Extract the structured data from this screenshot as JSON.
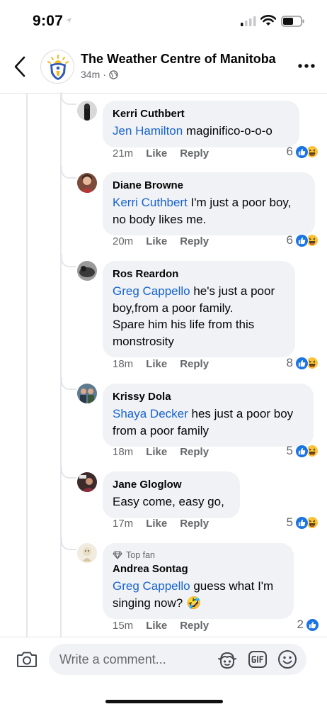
{
  "status_bar": {
    "time": "9:07"
  },
  "header": {
    "page_name": "The Weather Centre of Manitoba",
    "age": "34m",
    "separator": "·"
  },
  "comments": [
    {
      "author": "Kerri Cuthbert",
      "mention": "Jen Hamilton",
      "text": " maginifico-o-o-o",
      "time": "21m",
      "like": "Like",
      "reply": "Reply",
      "reaction_count": "6",
      "reactions": [
        "like-icon",
        "haha-icon"
      ]
    },
    {
      "author": "Diane Browne",
      "mention": "Kerri Cuthbert",
      "text": " I'm just a poor boy, no body likes me.",
      "time": "20m",
      "like": "Like",
      "reply": "Reply",
      "reaction_count": "6",
      "reactions": [
        "like-icon",
        "haha-icon"
      ]
    },
    {
      "author": "Ros Reardon",
      "mention": "Greg Cappello",
      "text": " he's just a poor boy,from a poor family.\nSpare him his life  from this monstrosity",
      "time": "18m",
      "like": "Like",
      "reply": "Reply",
      "reaction_count": "8",
      "reactions": [
        "like-icon",
        "haha-icon"
      ]
    },
    {
      "author": "Krissy Dola",
      "mention": "Shaya Decker",
      "text": " hes just a poor boy from a poor family",
      "time": "18m",
      "like": "Like",
      "reply": "Reply",
      "reaction_count": "5",
      "reactions": [
        "like-icon",
        "haha-icon"
      ]
    },
    {
      "author": "Jane Gloglow",
      "mention": "",
      "text": "Easy come, easy go,",
      "time": "17m",
      "like": "Like",
      "reply": "Reply",
      "reaction_count": "5",
      "reactions": [
        "like-icon",
        "haha-icon"
      ]
    },
    {
      "badge": "Top fan",
      "author": "Andrea Sontag",
      "mention": "Greg Cappello",
      "text": " guess what I'm singing now?  🤣",
      "time": "15m",
      "like": "Like",
      "reply": "Reply",
      "reaction_count": "2",
      "reactions": [
        "like-icon"
      ]
    }
  ],
  "composer": {
    "placeholder": "Write a comment...",
    "icons": [
      "camera-icon",
      "avatar-sticker-icon",
      "gif-icon",
      "emoji-icon"
    ]
  },
  "colors": {
    "link": "#1763cf",
    "like_blue": "#1b74e4",
    "bubble_bg": "#f0f2f5",
    "meta_gray": "#65676b"
  }
}
